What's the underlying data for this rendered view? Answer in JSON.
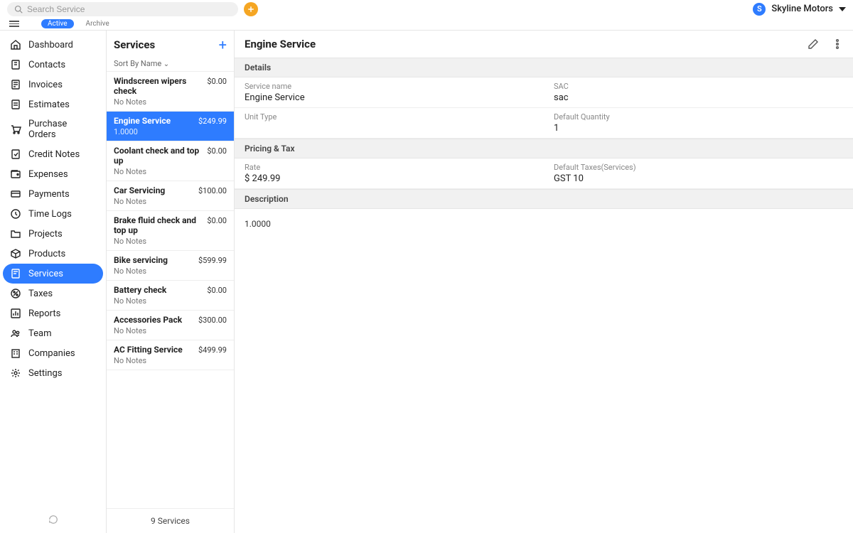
{
  "search": {
    "placeholder": "Search Service"
  },
  "account": {
    "initial": "S",
    "name": "Skyline Motors"
  },
  "tabs": {
    "active": "Active",
    "archive": "Archive"
  },
  "nav": [
    {
      "label": "Dashboard",
      "icon": "home"
    },
    {
      "label": "Contacts",
      "icon": "contacts"
    },
    {
      "label": "Invoices",
      "icon": "invoice"
    },
    {
      "label": "Estimates",
      "icon": "estimate"
    },
    {
      "label": "Purchase Orders",
      "icon": "cart"
    },
    {
      "label": "Credit Notes",
      "icon": "creditnote"
    },
    {
      "label": "Expenses",
      "icon": "wallet"
    },
    {
      "label": "Payments",
      "icon": "payments"
    },
    {
      "label": "Time Logs",
      "icon": "clock"
    },
    {
      "label": "Projects",
      "icon": "folder"
    },
    {
      "label": "Products",
      "icon": "cube"
    },
    {
      "label": "Services",
      "icon": "services",
      "selected": true
    },
    {
      "label": "Taxes",
      "icon": "percent"
    },
    {
      "label": "Reports",
      "icon": "chart"
    },
    {
      "label": "Team",
      "icon": "team"
    },
    {
      "label": "Companies",
      "icon": "company"
    },
    {
      "label": "Settings",
      "icon": "gear"
    }
  ],
  "list": {
    "title": "Services",
    "sort": "Sort By Name",
    "items": [
      {
        "title": "Windscreen wipers check",
        "price": "$0.00",
        "sub": "No Notes"
      },
      {
        "title": "Engine Service",
        "price": "$249.99",
        "sub": "1.0000",
        "selected": true
      },
      {
        "title": "Coolant check and top up",
        "price": "$0.00",
        "sub": "No Notes"
      },
      {
        "title": "Car Servicing",
        "price": "$100.00",
        "sub": "No Notes"
      },
      {
        "title": "Brake fluid check and top up",
        "price": "$0.00",
        "sub": "No Notes"
      },
      {
        "title": "Bike servicing",
        "price": "$599.99",
        "sub": "No Notes"
      },
      {
        "title": "Battery check",
        "price": "$0.00",
        "sub": "No Notes"
      },
      {
        "title": "Accessories Pack",
        "price": "$300.00",
        "sub": "No Notes"
      },
      {
        "title": "AC Fitting Service",
        "price": "$499.99",
        "sub": "No Notes"
      }
    ],
    "footer": "9 Services"
  },
  "detail": {
    "title": "Engine Service",
    "sections": {
      "details": "Details",
      "pricing": "Pricing & Tax",
      "description": "Description"
    },
    "fields": {
      "service_name_lbl": "Service name",
      "service_name_val": "Engine Service",
      "sac_lbl": "SAC",
      "sac_val": "sac",
      "unit_type_lbl": "Unit Type",
      "unit_type_val": "",
      "default_qty_lbl": "Default Quantity",
      "default_qty_val": "1",
      "rate_lbl": "Rate",
      "rate_val": "$ 249.99",
      "tax_lbl": "Default Taxes(Services)",
      "tax_val": "GST 10"
    },
    "description_val": "1.0000"
  }
}
